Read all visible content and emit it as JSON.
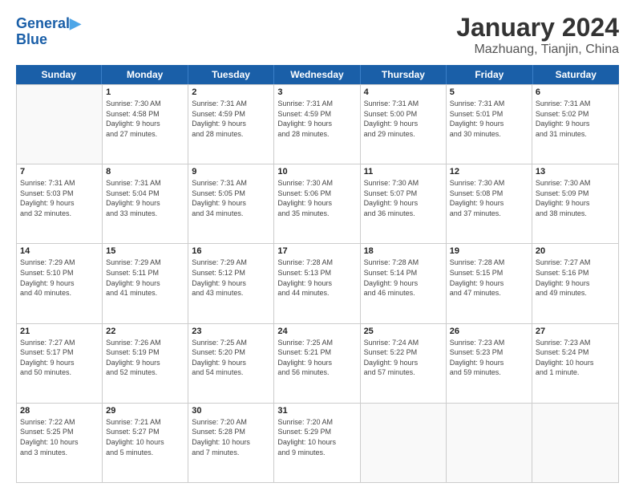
{
  "header": {
    "logo_line1": "General",
    "logo_line2": "Blue",
    "month_title": "January 2024",
    "location": "Mazhuang, Tianjin, China"
  },
  "weekdays": [
    "Sunday",
    "Monday",
    "Tuesday",
    "Wednesday",
    "Thursday",
    "Friday",
    "Saturday"
  ],
  "rows": [
    [
      {
        "day": "",
        "info": ""
      },
      {
        "day": "1",
        "info": "Sunrise: 7:30 AM\nSunset: 4:58 PM\nDaylight: 9 hours\nand 27 minutes."
      },
      {
        "day": "2",
        "info": "Sunrise: 7:31 AM\nSunset: 4:59 PM\nDaylight: 9 hours\nand 28 minutes."
      },
      {
        "day": "3",
        "info": "Sunrise: 7:31 AM\nSunset: 4:59 PM\nDaylight: 9 hours\nand 28 minutes."
      },
      {
        "day": "4",
        "info": "Sunrise: 7:31 AM\nSunset: 5:00 PM\nDaylight: 9 hours\nand 29 minutes."
      },
      {
        "day": "5",
        "info": "Sunrise: 7:31 AM\nSunset: 5:01 PM\nDaylight: 9 hours\nand 30 minutes."
      },
      {
        "day": "6",
        "info": "Sunrise: 7:31 AM\nSunset: 5:02 PM\nDaylight: 9 hours\nand 31 minutes."
      }
    ],
    [
      {
        "day": "7",
        "info": "Sunrise: 7:31 AM\nSunset: 5:03 PM\nDaylight: 9 hours\nand 32 minutes."
      },
      {
        "day": "8",
        "info": "Sunrise: 7:31 AM\nSunset: 5:04 PM\nDaylight: 9 hours\nand 33 minutes."
      },
      {
        "day": "9",
        "info": "Sunrise: 7:31 AM\nSunset: 5:05 PM\nDaylight: 9 hours\nand 34 minutes."
      },
      {
        "day": "10",
        "info": "Sunrise: 7:30 AM\nSunset: 5:06 PM\nDaylight: 9 hours\nand 35 minutes."
      },
      {
        "day": "11",
        "info": "Sunrise: 7:30 AM\nSunset: 5:07 PM\nDaylight: 9 hours\nand 36 minutes."
      },
      {
        "day": "12",
        "info": "Sunrise: 7:30 AM\nSunset: 5:08 PM\nDaylight: 9 hours\nand 37 minutes."
      },
      {
        "day": "13",
        "info": "Sunrise: 7:30 AM\nSunset: 5:09 PM\nDaylight: 9 hours\nand 38 minutes."
      }
    ],
    [
      {
        "day": "14",
        "info": "Sunrise: 7:29 AM\nSunset: 5:10 PM\nDaylight: 9 hours\nand 40 minutes."
      },
      {
        "day": "15",
        "info": "Sunrise: 7:29 AM\nSunset: 5:11 PM\nDaylight: 9 hours\nand 41 minutes."
      },
      {
        "day": "16",
        "info": "Sunrise: 7:29 AM\nSunset: 5:12 PM\nDaylight: 9 hours\nand 43 minutes."
      },
      {
        "day": "17",
        "info": "Sunrise: 7:28 AM\nSunset: 5:13 PM\nDaylight: 9 hours\nand 44 minutes."
      },
      {
        "day": "18",
        "info": "Sunrise: 7:28 AM\nSunset: 5:14 PM\nDaylight: 9 hours\nand 46 minutes."
      },
      {
        "day": "19",
        "info": "Sunrise: 7:28 AM\nSunset: 5:15 PM\nDaylight: 9 hours\nand 47 minutes."
      },
      {
        "day": "20",
        "info": "Sunrise: 7:27 AM\nSunset: 5:16 PM\nDaylight: 9 hours\nand 49 minutes."
      }
    ],
    [
      {
        "day": "21",
        "info": "Sunrise: 7:27 AM\nSunset: 5:17 PM\nDaylight: 9 hours\nand 50 minutes."
      },
      {
        "day": "22",
        "info": "Sunrise: 7:26 AM\nSunset: 5:19 PM\nDaylight: 9 hours\nand 52 minutes."
      },
      {
        "day": "23",
        "info": "Sunrise: 7:25 AM\nSunset: 5:20 PM\nDaylight: 9 hours\nand 54 minutes."
      },
      {
        "day": "24",
        "info": "Sunrise: 7:25 AM\nSunset: 5:21 PM\nDaylight: 9 hours\nand 56 minutes."
      },
      {
        "day": "25",
        "info": "Sunrise: 7:24 AM\nSunset: 5:22 PM\nDaylight: 9 hours\nand 57 minutes."
      },
      {
        "day": "26",
        "info": "Sunrise: 7:23 AM\nSunset: 5:23 PM\nDaylight: 9 hours\nand 59 minutes."
      },
      {
        "day": "27",
        "info": "Sunrise: 7:23 AM\nSunset: 5:24 PM\nDaylight: 10 hours\nand 1 minute."
      }
    ],
    [
      {
        "day": "28",
        "info": "Sunrise: 7:22 AM\nSunset: 5:25 PM\nDaylight: 10 hours\nand 3 minutes."
      },
      {
        "day": "29",
        "info": "Sunrise: 7:21 AM\nSunset: 5:27 PM\nDaylight: 10 hours\nand 5 minutes."
      },
      {
        "day": "30",
        "info": "Sunrise: 7:20 AM\nSunset: 5:28 PM\nDaylight: 10 hours\nand 7 minutes."
      },
      {
        "day": "31",
        "info": "Sunrise: 7:20 AM\nSunset: 5:29 PM\nDaylight: 10 hours\nand 9 minutes."
      },
      {
        "day": "",
        "info": ""
      },
      {
        "day": "",
        "info": ""
      },
      {
        "day": "",
        "info": ""
      }
    ]
  ]
}
